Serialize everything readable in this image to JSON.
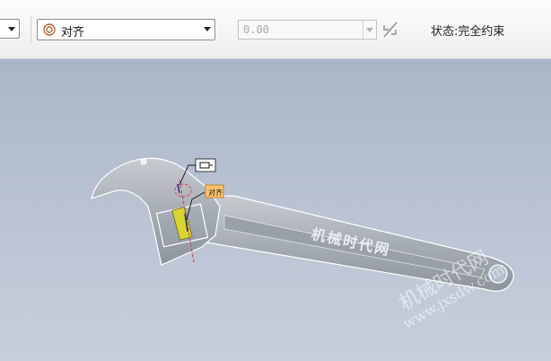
{
  "toolbar": {
    "constraint_type": "对齐",
    "offset_value": "0.00",
    "status_text": "状态:完全约束"
  },
  "viewport": {
    "wrench_label": "机械时代网",
    "tag_callout_1": "对齐",
    "watermark_text": "机械时代网",
    "watermark_url": "www.jxsdw.com"
  },
  "colors": {
    "viewport_bg": "#b9c3d2",
    "tag_highlight": "#ffc36b",
    "part_yellow": "#d8d530"
  },
  "icons": [
    "dropdown-arrow-icon",
    "concentric-circles-icon",
    "flip-arrow-icon",
    "constraint-flag-icon"
  ]
}
